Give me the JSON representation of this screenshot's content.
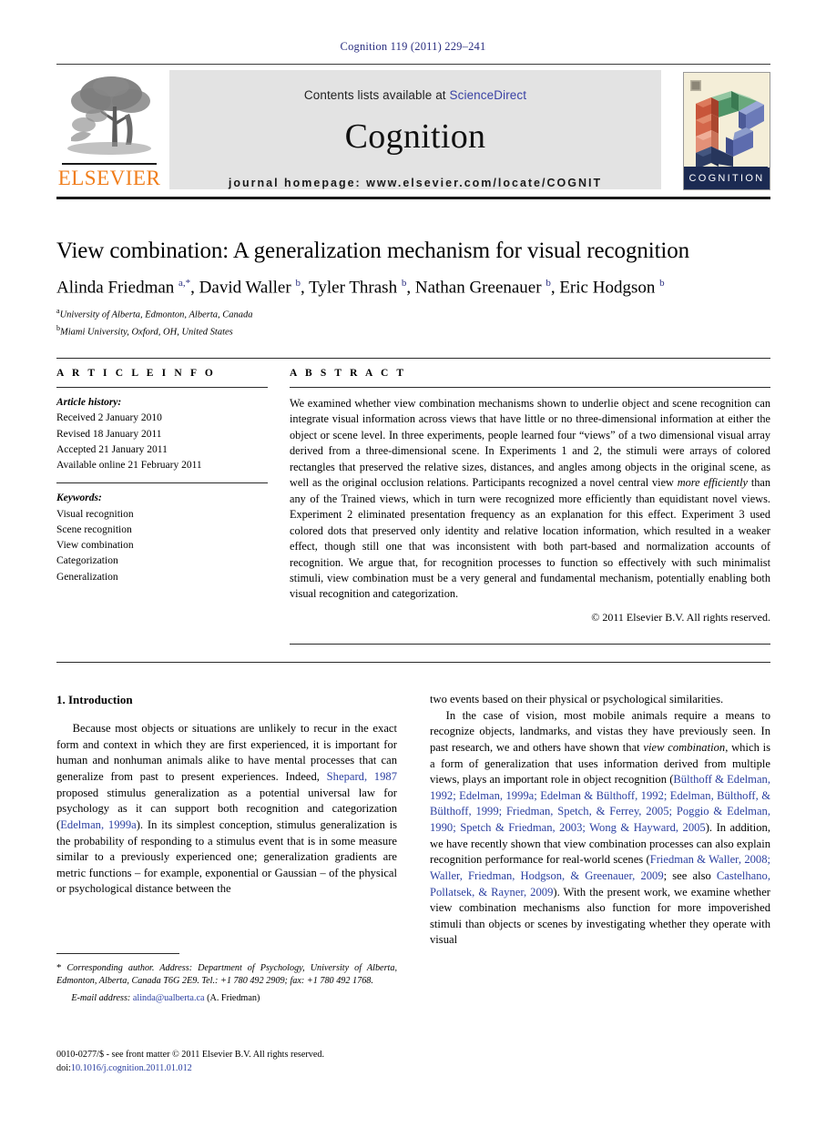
{
  "running_head": "Cognition 119 (2011) 229–241",
  "masthead": {
    "contents_prefix": "Contents lists available at ",
    "sciencedirect": "ScienceDirect",
    "journal_name": "Cognition",
    "homepage": "journal homepage: www.elsevier.com/locate/COGNIT",
    "publisher_wordmark": "ELSEVIER",
    "cover_caption": "COGNITION",
    "link_color": "#3a42a5",
    "publisher_color": "#f07d1a"
  },
  "article": {
    "title": "View combination: A generalization mechanism for visual recognition",
    "authors_html": "Alinda Friedman <sup>a,<span class=\"star\">*</span></sup>, David Waller <sup>b</sup>, Tyler Thrash <sup>b</sup>, Nathan Greenauer <sup>b</sup>, Eric Hodgson <sup>b</sup>",
    "affiliations": [
      {
        "marker": "a",
        "text": "University of Alberta, Edmonton, Alberta, Canada"
      },
      {
        "marker": "b",
        "text": "Miami University, Oxford, OH, United States"
      }
    ]
  },
  "info": {
    "heading": "A R T I C L E  I N F O",
    "history_label": "Article history:",
    "history": [
      "Received 2 January 2010",
      "Revised 18 January 2011",
      "Accepted 21 January 2011",
      "Available online 21 February 2011"
    ],
    "keywords_label": "Keywords:",
    "keywords": [
      "Visual recognition",
      "Scene recognition",
      "View combination",
      "Categorization",
      "Generalization"
    ]
  },
  "abstract": {
    "heading": "A B S T R A C T",
    "body_html": "We examined whether view combination mechanisms shown to underlie object and scene recognition can integrate visual information across views that have little or no three-dimensional information at either the object or scene level. In three experiments, people learned four “views” of a two dimensional visual array derived from a three-dimensional scene. In Experiments 1 and 2, the stimuli were arrays of colored rectangles that preserved the relative sizes, distances, and angles among objects in the original scene, as well as the original occlusion relations. Participants recognized a novel central view <i>more efficiently</i> than any of the Trained views, which in turn were recognized more efficiently than equidistant novel views. Experiment 2 eliminated presentation frequency as an explanation for this effect. Experiment 3 used colored dots that preserved only identity and relative location information, which resulted in a weaker effect, though still one that was inconsistent with both part-based and normalization accounts of recognition. We argue that, for recognition processes to function so effectively with such minimalist stimuli, view combination must be a very general and fundamental mechanism, potentially enabling both visual recognition and categorization.",
    "copyright": "© 2011 Elsevier B.V. All rights reserved."
  },
  "body": {
    "section_heading": "1. Introduction",
    "left_paragraphs_html": [
      "Because most objects or situations are unlikely to recur in the exact form and context in which they are first experienced, it is important for human and nonhuman animals alike to have mental processes that can generalize from past to present experiences. Indeed, <span class=\"ref\">Shepard, 1987</span> proposed stimulus generalization as a potential universal law for psychology as it can support both recognition and categorization (<span class=\"ref\">Edelman, 1999a</span>). In its simplest conception, stimulus generalization is the probability of responding to a stimulus event that is in some measure similar to a previously experienced one; generalization gradients are metric functions – for example, exponential or Gaussian – of the physical or psychological distance between the"
    ],
    "right_paragraphs_html": [
      "two events based on their physical or psychological similarities.",
      "In the case of vision, most mobile animals require a means to recognize objects, landmarks, and vistas they have previously seen. In past research, we and others have shown that <i>view combination</i>, which is a form of generalization that uses information derived from multiple views, plays an important role in object recognition (<span class=\"ref\">Bülthoff &amp; Edelman, 1992; Edelman, 1999a; Edelman &amp; Bülthoff, 1992; Edelman, Bülthoff, &amp; Bülthoff, 1999; Friedman, Spetch, &amp; Ferrey, 2005; Poggio &amp; Edelman, 1990; Spetch &amp; Friedman, 2003; Wong &amp; Hayward, 2005</span>). In addition, we have recently shown that view combination processes can also explain recognition performance for real-world scenes (<span class=\"ref\">Friedman &amp; Waller, 2008; Waller, Friedman, Hodgson, &amp; Greenauer, 2009</span>; see also <span class=\"ref\">Castelhano, Pollatsek, &amp; Rayner, 2009</span>). With the present work, we examine whether view combination mechanisms also function for more impoverished stimuli than objects or scenes by investigating whether they operate with visual"
    ]
  },
  "footnote": {
    "corresponding_html": "<span class=\"star\">*</span> <span class=\"em\">Corresponding author. Address: Department of Psychology, University of Alberta, Edmonton, Alberta, Canada T6G 2E9. Tel.: +1 780 492 2909; fax: +1 780 492 1768.</span>",
    "email_label": "E-mail address:",
    "email": "alinda@ualberta.ca",
    "email_attrib": "(A. Friedman)"
  },
  "imprint": {
    "line1": "0010-0277/$ - see front matter © 2011 Elsevier B.V. All rights reserved.",
    "doi_label": "doi:",
    "doi": "10.1016/j.cognition.2011.01.012"
  }
}
